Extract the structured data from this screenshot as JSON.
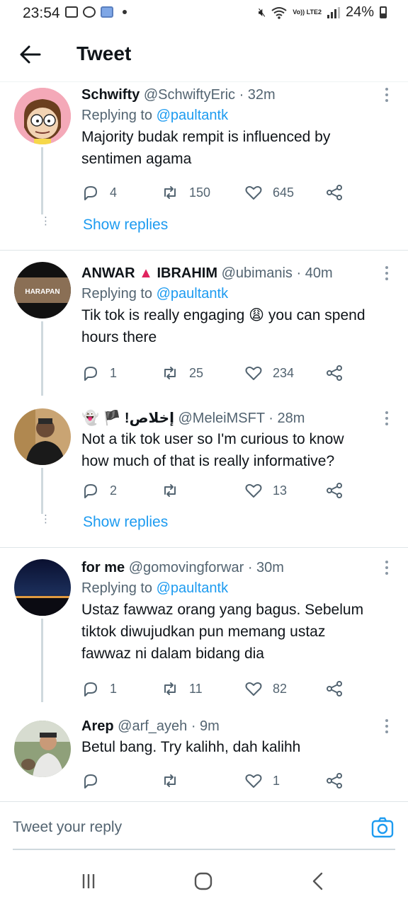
{
  "status": {
    "time": "23:54",
    "battery": "24%",
    "volte": "Vo)) LTE2"
  },
  "header": {
    "title": "Tweet"
  },
  "tweets": [
    {
      "name": "Schwifty",
      "handle": "@SchwiftyEric",
      "time": "· 32m",
      "replying_label": "Replying to",
      "replying_to": "@paultantk",
      "lines": [
        "Majority budak rempit is influenced by",
        "sentimen agama"
      ],
      "replies": "4",
      "retweets": "150",
      "likes": "645",
      "show_replies": "Show replies"
    },
    {
      "name": "ANWAR ▲ IBRAHIM",
      "handle": "@ubimanis",
      "time": "· 40m",
      "replying_label": "Replying to",
      "replying_to": "@paultantk",
      "lines": [
        "Tik tok is really engaging 😩 you can spend",
        "hours there"
      ],
      "replies": "1",
      "retweets": "25",
      "likes": "234",
      "avatar_text": "HARAPAN"
    },
    {
      "name": "👻 🏴 !إخلاص",
      "handle": "@MeleiMSFT",
      "time": "· 28m",
      "lines": [
        "Not a tik tok user so I'm curious to know",
        "how much of that is really informative?"
      ],
      "replies": "2",
      "retweets": "",
      "likes": "13",
      "show_replies": "Show replies"
    },
    {
      "name": "for me",
      "handle": "@gomovingforwar",
      "time": "· 30m",
      "replying_label": "Replying to",
      "replying_to": "@paultantk",
      "lines": [
        "Ustaz fawwaz orang yang bagus. Sebelum",
        "tiktok diwujudkan pun memang ustaz",
        "fawwaz ni dalam bidang dia"
      ],
      "replies": "1",
      "retweets": "11",
      "likes": "82"
    },
    {
      "name": "Arep",
      "handle": "@arf_ayeh",
      "time": "· 9m",
      "lines": [
        "Betul bang. Try kalihh, dah kalihh"
      ],
      "replies": "",
      "retweets": "",
      "likes": "1"
    }
  ],
  "reply_bar": {
    "placeholder": "Tweet your reply"
  },
  "colors": {
    "accent": "#1d9bf0",
    "secondary_text": "#536471",
    "anwar_triangle": "#e0245e"
  }
}
